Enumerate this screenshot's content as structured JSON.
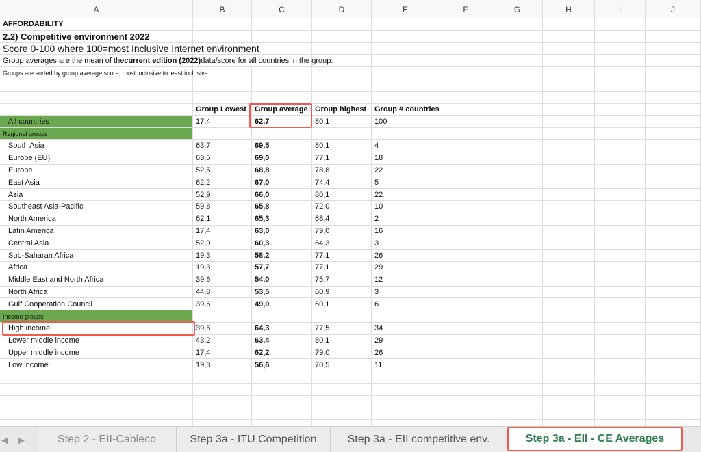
{
  "columns": [
    "A",
    "B",
    "C",
    "D",
    "E",
    "F",
    "G",
    "H",
    "I",
    "J"
  ],
  "header_lines": {
    "line1": "AFFORDABILITY",
    "line2": "2.2) Competitive environment 2022",
    "line3": "Score 0-100 where 100=most Inclusive Internet environment",
    "line4_pre": "Group averages are the mean of the ",
    "line4_bold": "current edition (2022)",
    "line4_post": " data/score for all countries in the group.",
    "line5": "Groups are sorted by group average score, most inclusive to least inclusive"
  },
  "table_headers": {
    "lowest": "Group Lowest",
    "average": "Group average",
    "highest": "Group highest",
    "count": "Group # countries"
  },
  "all_countries": {
    "name": "All countries",
    "lowest": "17,4",
    "average": "62,7",
    "highest": "80,1",
    "count": "100"
  },
  "regional_label": "Regional groups",
  "regional": [
    {
      "name": "South Asia",
      "lowest": "63,7",
      "average": "69,5",
      "highest": "80,1",
      "count": "4"
    },
    {
      "name": "Europe (EU)",
      "lowest": "63,5",
      "average": "69,0",
      "highest": "77,1",
      "count": "18"
    },
    {
      "name": "Europe",
      "lowest": "52,5",
      "average": "68,8",
      "highest": "78,8",
      "count": "22"
    },
    {
      "name": "East Asia",
      "lowest": "62,2",
      "average": "67,0",
      "highest": "74,4",
      "count": "5"
    },
    {
      "name": "Asia",
      "lowest": "52,9",
      "average": "66,0",
      "highest": "80,1",
      "count": "22"
    },
    {
      "name": "Southeast Asia-Pacific",
      "lowest": "59,8",
      "average": "65,8",
      "highest": "72,0",
      "count": "10"
    },
    {
      "name": "North America",
      "lowest": "62,1",
      "average": "65,3",
      "highest": "68,4",
      "count": "2"
    },
    {
      "name": "Latin America",
      "lowest": "17,4",
      "average": "63,0",
      "highest": "79,0",
      "count": "16"
    },
    {
      "name": "Central Asia",
      "lowest": "52,9",
      "average": "60,3",
      "highest": "64,3",
      "count": "3"
    },
    {
      "name": "Sub-Saharan Africa",
      "lowest": "19,3",
      "average": "58,2",
      "highest": "77,1",
      "count": "26"
    },
    {
      "name": "Africa",
      "lowest": "19,3",
      "average": "57,7",
      "highest": "77,1",
      "count": "29"
    },
    {
      "name": "Middle East and North Africa",
      "lowest": "39,6",
      "average": "54,0",
      "highest": "75,7",
      "count": "12"
    },
    {
      "name": "North Africa",
      "lowest": "44,8",
      "average": "53,5",
      "highest": "60,9",
      "count": "3"
    },
    {
      "name": "Gulf Cooperation Council",
      "lowest": "39,6",
      "average": "49,0",
      "highest": "60,1",
      "count": "6"
    }
  ],
  "income_label": "Income groups",
  "income": [
    {
      "name": "High income",
      "lowest": "39,6",
      "average": "64,3",
      "highest": "77,5",
      "count": "34"
    },
    {
      "name": "Lower middle income",
      "lowest": "43,2",
      "average": "63,4",
      "highest": "80,1",
      "count": "29"
    },
    {
      "name": "Upper middle income",
      "lowest": "17,4",
      "average": "62,2",
      "highest": "79,0",
      "count": "26"
    },
    {
      "name": "Low income",
      "lowest": "19,3",
      "average": "56,6",
      "highest": "70,5",
      "count": "11"
    }
  ],
  "tabs": [
    {
      "label": "Step 2 - EII-Cableco"
    },
    {
      "label": "Step 3a - ITU Competition"
    },
    {
      "label": "Step 3a - EII competitive env."
    },
    {
      "label": "Step 3a - EII - CE Averages"
    }
  ],
  "colors": {
    "group_fill": "#6aa84f",
    "highlight": "#ef5b4c",
    "active_tab_text": "#2e7d4f"
  }
}
